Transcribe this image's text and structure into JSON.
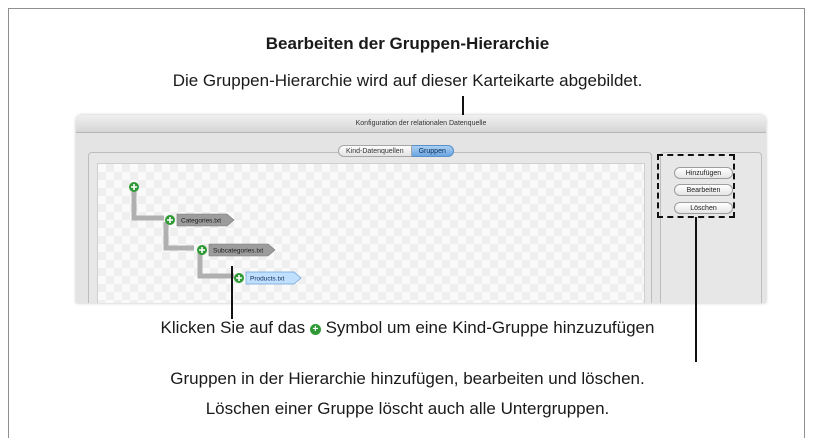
{
  "page": {
    "title": "Bearbeiten der Gruppen-Hierarchie",
    "subtitle": "Die Gruppen-Hierarchie wird auf dieser Karteikarte abgebildet.",
    "caption_click_before": "Klicken Sie auf das ",
    "caption_click_after": " Symbol um eine Kind-Gruppe hinzuzufügen",
    "caption_line1": "Gruppen in der Hierarchie hinzufügen, bearbeiten und löschen.",
    "caption_line2": "Löschen einer Gruppe löscht auch alle Untergruppen."
  },
  "window": {
    "title": "Konfiguration der relationalen Datenquelle",
    "tabs": [
      {
        "label": "Kind-Datenquellen",
        "active": false
      },
      {
        "label": "Gruppen",
        "active": true
      }
    ]
  },
  "tree": {
    "nodes": [
      {
        "label": "Categories.txt",
        "selected": false
      },
      {
        "label": "Subcategories.txt",
        "selected": false
      },
      {
        "label": "Products.txt",
        "selected": true
      }
    ],
    "add_icon": "plus-circle-icon"
  },
  "side_panel": {
    "add_label": "Hinzufügen",
    "edit_label": "Bearbeiten",
    "delete_label": "Löschen"
  },
  "colors": {
    "add_icon": "#2f9a35",
    "node_fill": "#9c9c9c",
    "node_selected_fill": "#bfe0ff",
    "connector": "#b0b0b0",
    "tab_active": "#6aa6e2"
  }
}
